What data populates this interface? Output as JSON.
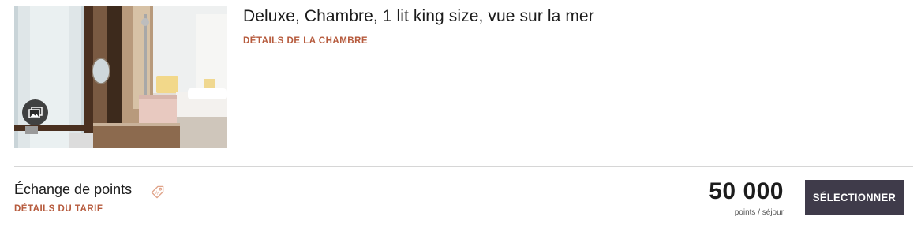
{
  "room": {
    "title": "Deluxe, Chambre, 1 lit king size, vue sur la mer",
    "details_link": "DÉTAILS DE LA CHAMBRE",
    "photo_icon": "photo-gallery-icon"
  },
  "rate": {
    "name": "Échange de points",
    "tag_icon": "tag-icon",
    "details_link": "DÉTAILS DU TARIF",
    "price": "50 000",
    "price_unit": "points / séjour",
    "select_label": "SÉLECTIONNER"
  },
  "colors": {
    "link": "#b65a3c",
    "button_bg": "#3f3b4a",
    "divider": "#d6d6d6",
    "tag_icon": "#e0a48a"
  }
}
